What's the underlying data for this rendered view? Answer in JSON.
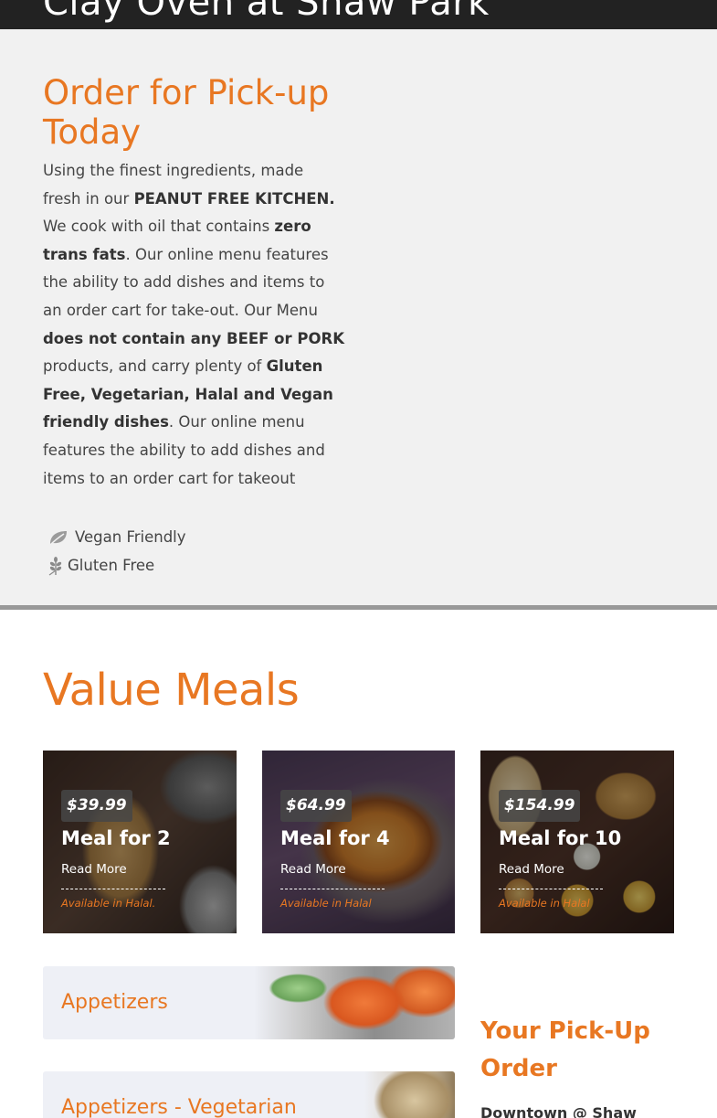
{
  "header": {
    "title": "Clay Oven at Shaw Park"
  },
  "intro": {
    "title": "Order for Pick-up Today",
    "text_parts": [
      "Using the finest ingredients, made fresh in our ",
      "PEANUT FREE KITCHEN.",
      " We cook with oil that contains ",
      "zero trans fats",
      ". Our online menu features the ability to add dishes and items to an order cart for take-out. Our Menu ",
      "does not contain any BEEF or PORK",
      " products, and carry plenty of ",
      "Gluten Free, Vegetarian, Halal and Vegan friendly dishes",
      ". Our online menu features the ability to add dishes and items to an order cart for takeout"
    ]
  },
  "legend": {
    "vegan": {
      "label": "Vegan Friendly",
      "icon": "leaf-icon"
    },
    "gluten_free": {
      "label": "Gluten Free",
      "icon": "wheat-icon"
    }
  },
  "value_meals": {
    "title": "Value Meals",
    "cards": [
      {
        "price": "$39.99",
        "name": "Meal for 2",
        "link": "Read More",
        "note": "Available in Halal."
      },
      {
        "price": "$64.99",
        "name": "Meal for 4",
        "link": "Read More",
        "note": "Available in Halal"
      },
      {
        "price": "$154.99",
        "name": "Meal for 10",
        "link": "Read More",
        "note": "Available in Halal"
      }
    ]
  },
  "categories": [
    {
      "label": "Appetizers"
    },
    {
      "label": "Appetizers - Vegetarian"
    }
  ],
  "pickup": {
    "title": "Your Pick-Up Order",
    "location": "Downtown @ Shaw"
  },
  "colors": {
    "accent": "#e87722",
    "topbar": "#222222",
    "intro_bg": "#f1f1f1"
  }
}
